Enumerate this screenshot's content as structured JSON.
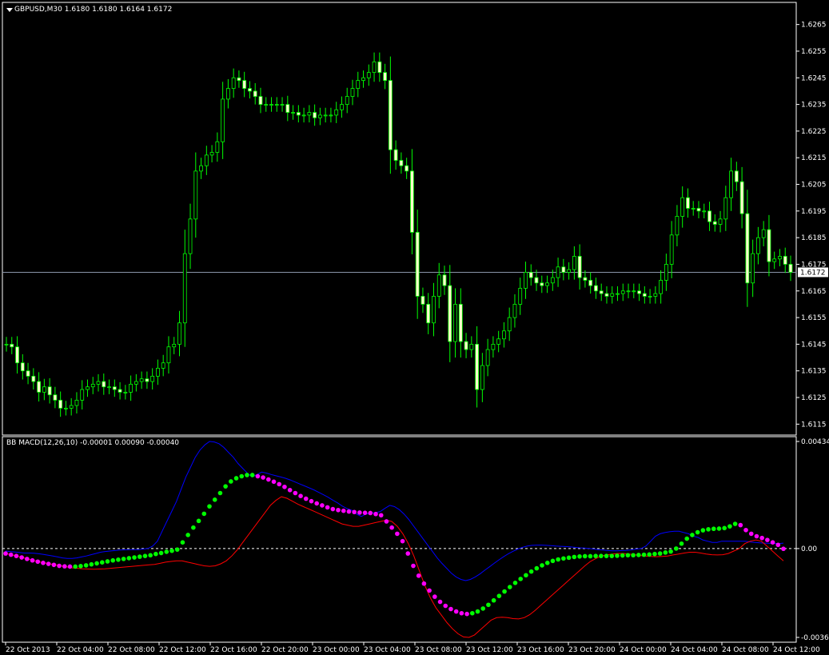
{
  "window": {
    "symbol_title": "GBPUSD,M30  1.6180 1.6180 1.6164 1.6172",
    "indicator_title": "BB MACD(12,26,10) -0.00001 0.00090 -0.00040",
    "current_price_label": "1.6172"
  },
  "colors": {
    "background": "#000000",
    "candle": "#00ff00",
    "bull_body": "#000000",
    "bear_body": "#ffffcc",
    "price_line": "#8a94a8",
    "frame": "#ffffff",
    "macd_up_dot": "#00ff00",
    "macd_down_dot": "#ff00ff",
    "upper_band": "#0000ff",
    "lower_band": "#ff0000",
    "zero_line": "#ffffff"
  },
  "chart_data": {
    "type": "candlestick",
    "price_ticks": [
      "1.6265",
      "1.6255",
      "1.6245",
      "1.6235",
      "1.6225",
      "1.6215",
      "1.6205",
      "1.6195",
      "1.6185",
      "1.6175",
      "1.6165",
      "1.6155",
      "1.6145",
      "1.6135",
      "1.6125",
      "1.6115"
    ],
    "price_range": [
      1.61115,
      1.62715
    ],
    "indicator_ticks": [
      "0.00434",
      "0.00",
      "-0.0036"
    ],
    "indicator_range": [
      -0.0036,
      0.00434
    ],
    "time_labels": [
      "22 Oct 2013",
      "22 Oct 04:00",
      "22 Oct 08:00",
      "22 Oct 12:00",
      "22 Oct 16:00",
      "22 Oct 20:00",
      "23 Oct 00:00",
      "23 Oct 04:00",
      "23 Oct 08:00",
      "23 Oct 12:00",
      "23 Oct 16:00",
      "23 Oct 20:00",
      "24 Oct 00:00",
      "24 Oct 04:00",
      "24 Oct 08:00",
      "24 Oct 12:00"
    ],
    "current_price": 1.6172,
    "closes": [
      1.6145,
      1.6144,
      1.6138,
      1.6135,
      1.6133,
      1.6131,
      1.6127,
      1.6129,
      1.6126,
      1.6124,
      1.6121,
      1.6121,
      1.6122,
      1.6124,
      1.6128,
      1.6129,
      1.613,
      1.6131,
      1.6129,
      1.6129,
      1.6128,
      1.6127,
      1.6127,
      1.613,
      1.6131,
      1.6132,
      1.6131,
      1.6133,
      1.6136,
      1.6138,
      1.6144,
      1.6145,
      1.6153,
      1.6179,
      1.6192,
      1.621,
      1.6212,
      1.6216,
      1.6217,
      1.6221,
      1.6237,
      1.6241,
      1.6245,
      1.6244,
      1.6241,
      1.624,
      1.6238,
      1.6235,
      1.6235,
      1.6235,
      1.6235,
      1.6235,
      1.6232,
      1.6232,
      1.6231,
      1.6231,
      1.6232,
      1.623,
      1.6231,
      1.6231,
      1.6231,
      1.6233,
      1.6235,
      1.6238,
      1.6241,
      1.6244,
      1.6245,
      1.6247,
      1.6251,
      1.6247,
      1.6244,
      1.6218,
      1.6214,
      1.6212,
      1.621,
      1.6187,
      1.6163,
      1.616,
      1.6153,
      1.6163,
      1.6171,
      1.6167,
      1.6146,
      1.616,
      1.6146,
      1.6143,
      1.6145,
      1.6128,
      1.6137,
      1.6143,
      1.6145,
      1.6147,
      1.615,
      1.6155,
      1.616,
      1.6166,
      1.6172,
      1.617,
      1.6168,
      1.6167,
      1.6168,
      1.617,
      1.6174,
      1.6172,
      1.6173,
      1.6178,
      1.617,
      1.6169,
      1.6167,
      1.6165,
      1.6164,
      1.6163,
      1.6164,
      1.6164,
      1.6165,
      1.6165,
      1.6165,
      1.6164,
      1.6163,
      1.6163,
      1.6164,
      1.6169,
      1.6175,
      1.6186,
      1.6193,
      1.62,
      1.6196,
      1.6196,
      1.6195,
      1.6195,
      1.6191,
      1.619,
      1.6192,
      1.62,
      1.621,
      1.6206,
      1.6194,
      1.6168,
      1.6179,
      1.6185,
      1.6188,
      1.6176,
      1.6177,
      1.6178,
      1.6175,
      1.6172
    ],
    "macd_signal": [
      -0.0002,
      -0.00025,
      -0.0003,
      -0.00036,
      -0.00042,
      -0.00048,
      -0.00053,
      -0.00058,
      -0.00062,
      -0.00066,
      -0.0007,
      -0.00072,
      -0.00073,
      -0.00073,
      -0.00071,
      -0.00068,
      -0.00064,
      -0.0006,
      -0.00056,
      -0.00052,
      -0.00048,
      -0.00045,
      -0.00042,
      -0.00039,
      -0.00036,
      -0.00033,
      -0.0003,
      -0.00027,
      -0.00022,
      -0.00018,
      -0.00013,
      -9e-05,
      -4e-05,
      0.00025,
      0.00055,
      0.00085,
      0.00112,
      0.00141,
      0.00171,
      0.00198,
      0.00225,
      0.00252,
      0.00272,
      0.00285,
      0.00293,
      0.00298,
      0.00298,
      0.00293,
      0.00288,
      0.0028,
      0.00271,
      0.00261,
      0.0025,
      0.00237,
      0.00225,
      0.00213,
      0.00202,
      0.00192,
      0.00183,
      0.00175,
      0.00167,
      0.0016,
      0.00156,
      0.00153,
      0.0015,
      0.00148,
      0.00146,
      0.00145,
      0.00144,
      0.0014,
      0.00135,
      0.0011,
      0.00085,
      0.0006,
      0.0003,
      -0.0002,
      -0.0007,
      -0.0011,
      -0.00142,
      -0.0017,
      -0.00195,
      -0.00216,
      -0.00232,
      -0.00245,
      -0.00255,
      -0.00262,
      -0.00265,
      -0.00262,
      -0.00255,
      -0.00243,
      -0.00228,
      -0.0021,
      -0.00192,
      -0.00174,
      -0.00156,
      -0.00139,
      -0.00123,
      -0.00108,
      -0.00093,
      -0.0008,
      -0.00068,
      -0.00058,
      -0.0005,
      -0.00044,
      -0.0004,
      -0.00037,
      -0.00034,
      -0.00032,
      -0.00031,
      -0.00031,
      -0.0003,
      -0.0003,
      -0.0003,
      -0.0003,
      -0.00029,
      -0.00028,
      -0.00027,
      -0.00027,
      -0.00026,
      -0.00025,
      -0.00024,
      -0.00022,
      -0.0002,
      -0.00016,
      -0.00012,
      0.0,
      0.0002,
      0.0004,
      0.00055,
      0.00066,
      0.00074,
      0.00078,
      0.0008,
      0.00081,
      0.00083,
      0.0009,
      0.001,
      0.00095,
      0.00075,
      0.0006,
      0.0005,
      0.00043,
      0.00035,
      0.00025,
      0.00015,
      -1e-05
    ],
    "upper_band": [
      -0.0001,
      -0.00012,
      -0.00014,
      -0.00016,
      -0.00018,
      -0.00018,
      -0.00019,
      -0.00021,
      -0.00024,
      -0.00027,
      -0.0003,
      -0.00034,
      -0.00038,
      -0.0004,
      -0.0004,
      -0.00038,
      -0.00034,
      -0.0003,
      -0.00025,
      -0.0002,
      -0.00015,
      -0.00012,
      -0.0001,
      -8e-05,
      -6e-05,
      -5e-05,
      -4e-05,
      -4e-05,
      -4e-05,
      -2e-05,
      0.0,
      0.0001,
      0.0003,
      0.0007,
      0.0011,
      0.0015,
      0.0019,
      0.0024,
      0.0029,
      0.0033,
      0.0037,
      0.004,
      0.0042,
      0.00434,
      0.00432,
      0.00425,
      0.0041,
      0.0039,
      0.0037,
      0.00345,
      0.00325,
      0.00305,
      0.0029,
      0.003,
      0.0031,
      0.00306,
      0.003,
      0.00295,
      0.0029,
      0.00285,
      0.00278,
      0.0027,
      0.00262,
      0.00254,
      0.00246,
      0.00238,
      0.00228,
      0.00218,
      0.00208,
      0.00196,
      0.00185,
      0.00172,
      0.00162,
      0.00155,
      0.0014,
      0.0013,
      0.0014,
      0.00143,
      0.00146,
      0.0015,
      0.00163,
      0.00175,
      0.0017,
      0.00158,
      0.0014,
      0.00118,
      0.00092,
      0.00066,
      0.0004,
      0.00014,
      -0.00012,
      -0.00038,
      -0.0006,
      -0.0008,
      -0.001,
      -0.00115,
      -0.00125,
      -0.0013,
      -0.00125,
      -0.00115,
      -0.00103,
      -0.00088,
      -0.00074,
      -0.0006,
      -0.00046,
      -0.00033,
      -0.00021,
      -0.00011,
      -2e-05,
      5e-05,
      0.0001,
      0.00013,
      0.00014,
      0.00014,
      0.00013,
      0.00012,
      0.0001,
      9e-05,
      8e-05,
      7e-05,
      5e-05,
      3e-05,
      2e-05,
      0.0,
      -2e-05,
      -4e-05,
      -6e-05,
      -8e-05,
      -9e-05,
      -9e-05,
      -8e-05,
      -7e-05,
      -5e-05,
      -2e-05,
      0.0,
      0.0001,
      0.0003,
      0.0005,
      0.0006,
      0.00065,
      0.00068,
      0.0007,
      0.0007,
      0.00065,
      0.0006,
      0.0005,
      0.00045,
      0.00035,
      0.0003,
      0.00025,
      0.00025,
      0.0003,
      0.0003,
      0.0003,
      0.0003,
      0.0003,
      0.0003,
      0.00027,
      0.00025,
      0.00023,
      0.00022,
      0.00021,
      0.00021,
      0.0002,
      0.00022
    ],
    "lower_band": [
      -0.0002,
      -0.00025,
      -0.0003,
      -0.00036,
      -0.00042,
      -0.00048,
      -0.00053,
      -0.00058,
      -0.00062,
      -0.00066,
      -0.0007,
      -0.00074,
      -0.00078,
      -0.0008,
      -0.00082,
      -0.00083,
      -0.00084,
      -0.00083,
      -0.00082,
      -0.0008,
      -0.00078,
      -0.00076,
      -0.00074,
      -0.00072,
      -0.0007,
      -0.00068,
      -0.00066,
      -0.00064,
      -0.0006,
      -0.00055,
      -0.00052,
      -0.0005,
      -0.0005,
      -0.00055,
      -0.0006,
      -0.00065,
      -0.0007,
      -0.00072,
      -0.0007,
      -0.00062,
      -0.0005,
      -0.0003,
      -5e-05,
      0.00025,
      0.00055,
      0.00085,
      0.00115,
      0.00145,
      0.00175,
      0.00195,
      0.0021,
      0.00204,
      0.00192,
      0.0018,
      0.0017,
      0.0016,
      0.0015,
      0.0014,
      0.0013,
      0.0012,
      0.0011,
      0.001,
      0.00095,
      0.0009,
      0.0009,
      0.00095,
      0.001,
      0.00105,
      0.0011,
      0.00115,
      0.0011,
      0.0009,
      0.0006,
      0.0002,
      -0.0003,
      -0.0009,
      -0.0015,
      -0.002,
      -0.0024,
      -0.0027,
      -0.003,
      -0.00325,
      -0.00345,
      -0.00358,
      -0.0036,
      -0.0035,
      -0.0033,
      -0.0031,
      -0.0029,
      -0.0028,
      -0.00278,
      -0.0028,
      -0.00284,
      -0.00285,
      -0.0028,
      -0.00268,
      -0.0025,
      -0.0023,
      -0.0021,
      -0.0019,
      -0.0017,
      -0.0015,
      -0.0013,
      -0.0011,
      -0.0009,
      -0.0007,
      -0.00052,
      -0.0004,
      -0.0003,
      -0.00026,
      -0.00022,
      -0.0002,
      -0.0002,
      -0.00022,
      -0.00025,
      -0.00028,
      -0.0003,
      -0.00032,
      -0.00033,
      -0.00032,
      -0.0003,
      -0.00026,
      -0.00022,
      -0.00018,
      -0.00015,
      -0.00015,
      -0.00018,
      -0.00022,
      -0.00025,
      -0.00026,
      -0.00025,
      -0.0002,
      -0.0001,
      0.0,
      0.0002,
      0.0003,
      0.00035,
      0.0003,
      0.0001,
      -0.0001,
      -0.0003,
      -0.0005
    ]
  }
}
